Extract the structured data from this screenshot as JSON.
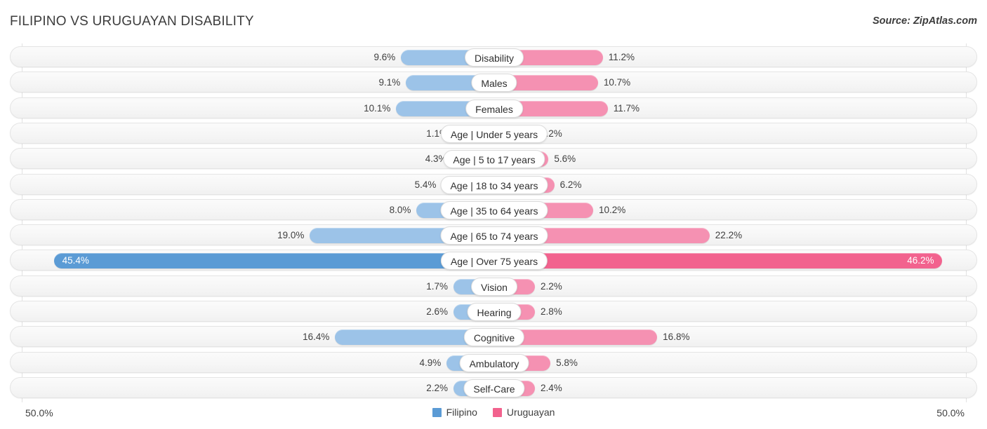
{
  "header": {
    "title": "FILIPINO VS URUGUAYAN DISABILITY",
    "source": "Source: ZipAtlas.com"
  },
  "axis": {
    "left_max_label": "50.0%",
    "right_max_label": "50.0%",
    "max": 50.0
  },
  "legend": {
    "items": [
      {
        "label": "Filipino",
        "color": "#5B9BD5"
      },
      {
        "label": "Uruguayan",
        "color": "#F2628E"
      }
    ]
  },
  "colors": {
    "filipino_light": "#9CC3E8",
    "filipino_dark": "#5B9BD5",
    "uruguayan_light": "#F591B2",
    "uruguayan_dark": "#F2628E",
    "row_track": "#f6f6f6",
    "gridline": "#e2e2e2"
  },
  "chart_data": {
    "type": "bar",
    "subtype": "diverging-bidirectional",
    "title": "FILIPINO VS URUGUAYAN DISABILITY",
    "xlabel": "",
    "ylabel": "",
    "xlim": [
      -50.0,
      50.0
    ],
    "grid": true,
    "legend_position": "bottom-center",
    "categories": [
      "Disability",
      "Males",
      "Females",
      "Age | Under 5 years",
      "Age | 5 to 17 years",
      "Age | 18 to 34 years",
      "Age | 35 to 64 years",
      "Age | 65 to 74 years",
      "Age | Over 75 years",
      "Vision",
      "Hearing",
      "Cognitive",
      "Ambulatory",
      "Self-Care"
    ],
    "series": [
      {
        "name": "Filipino",
        "values": [
          9.6,
          9.1,
          10.1,
          1.1,
          4.3,
          5.4,
          8.0,
          19.0,
          45.4,
          1.7,
          2.6,
          16.4,
          4.9,
          2.2
        ],
        "labels": [
          "9.6%",
          "9.1%",
          "10.1%",
          "1.1%",
          "4.3%",
          "5.4%",
          "8.0%",
          "19.0%",
          "45.4%",
          "1.7%",
          "2.6%",
          "16.4%",
          "4.9%",
          "2.2%"
        ]
      },
      {
        "name": "Uruguayan",
        "values": [
          11.2,
          10.7,
          11.7,
          1.2,
          5.6,
          6.2,
          10.2,
          22.2,
          46.2,
          2.2,
          2.8,
          16.8,
          5.8,
          2.4
        ],
        "labels": [
          "11.2%",
          "10.7%",
          "11.7%",
          "1.2%",
          "5.6%",
          "6.2%",
          "10.2%",
          "22.2%",
          "46.2%",
          "2.2%",
          "2.8%",
          "16.8%",
          "5.8%",
          "2.4%"
        ]
      }
    ],
    "highlighted_row": "Age | Over 75 years"
  }
}
